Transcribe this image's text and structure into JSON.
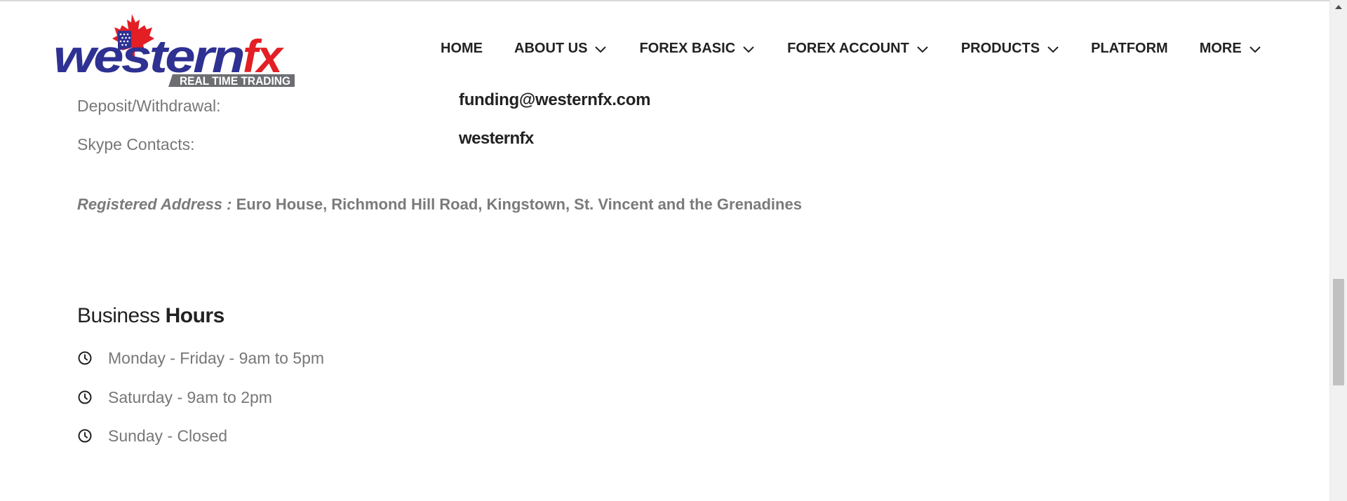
{
  "brand": {
    "logo_text_main": "western",
    "logo_text_fx": "fx",
    "logo_tagline": "REAL TIME TRADING"
  },
  "nav": {
    "items": [
      {
        "label": "HOME",
        "has_dropdown": false
      },
      {
        "label": "ABOUT US",
        "has_dropdown": true
      },
      {
        "label": "FOREX BASIC",
        "has_dropdown": true
      },
      {
        "label": "FOREX ACCOUNT",
        "has_dropdown": true
      },
      {
        "label": "PRODUCTS",
        "has_dropdown": true
      },
      {
        "label": "PLATFORM",
        "has_dropdown": false
      },
      {
        "label": "MORE",
        "has_dropdown": true
      }
    ]
  },
  "contacts": {
    "deposit_label": "Deposit/Withdrawal:",
    "deposit_value": "funding@westernfx.com",
    "skype_label": "Skype Contacts:",
    "skype_value": "westernfx"
  },
  "address": {
    "label": "Registered Address :",
    "value": "Euro House, Richmond Hill Road, Kingstown, St. Vincent and the Grenadines"
  },
  "business_hours": {
    "title_light": "Business",
    "title_bold": "Hours",
    "items": [
      "Monday - Friday - 9am to 5pm",
      "Saturday - 9am to 2pm",
      "Sunday - Closed"
    ]
  },
  "colors": {
    "logo_blue": "#2e3192",
    "logo_red": "#e31e24",
    "text_dark": "#222222",
    "text_grey": "#777777"
  },
  "icons": {
    "clock": "clock-icon",
    "chevron": "chevron-down-icon",
    "maple": "maple-leaf-icon"
  }
}
